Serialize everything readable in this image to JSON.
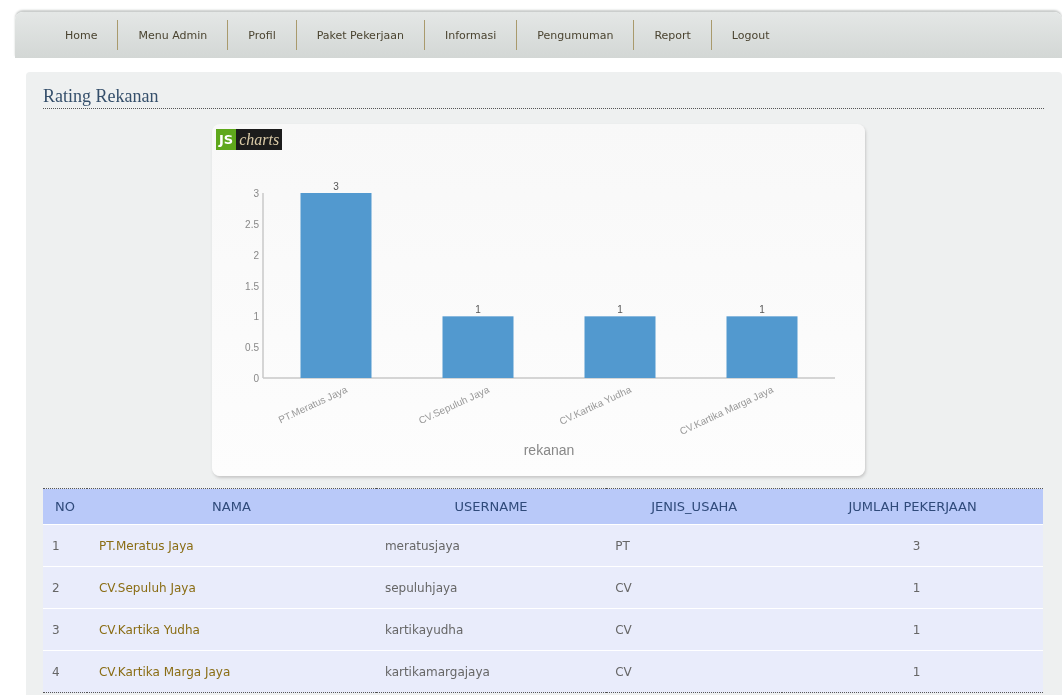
{
  "nav": {
    "items": [
      {
        "label": "Home"
      },
      {
        "label": "Menu Admin"
      },
      {
        "label": "Profil"
      },
      {
        "label": "Paket Pekerjaan"
      },
      {
        "label": "Informasi"
      },
      {
        "label": "Pengumuman"
      },
      {
        "label": "Report"
      },
      {
        "label": "Logout"
      }
    ]
  },
  "page_title": "Rating Rekanan",
  "chart": {
    "logo": {
      "left": "JS",
      "right": "charts"
    },
    "chart_data": {
      "type": "bar",
      "xlabel": "rekanan",
      "categories": [
        "PT.Meratus Jaya",
        "CV.Sepuluh Jaya",
        "CV.Kartika Yudha",
        "CV.Kartika Marga Jaya"
      ],
      "values": [
        3,
        1,
        1,
        1
      ],
      "ylim": [
        0,
        3
      ],
      "yticks": [
        0,
        0.5,
        1,
        1.5,
        2,
        2.5,
        3
      ],
      "data_labels": true
    }
  },
  "table": {
    "columns": [
      "NO",
      "NAMA",
      "USERNAME",
      "JENIS_USAHA",
      "JUMLAH PEKERJAAN"
    ],
    "rows": [
      [
        "1",
        "PT.Meratus Jaya",
        "meratusjaya",
        "PT",
        "3"
      ],
      [
        "2",
        "CV.Sepuluh Jaya",
        "sepuluhjaya",
        "CV",
        "1"
      ],
      [
        "3",
        "CV.Kartika Yudha",
        "kartikayudha",
        "CV",
        "1"
      ],
      [
        "4",
        "CV.Kartika Marga Jaya",
        "kartikamargajaya",
        "CV",
        "1"
      ]
    ]
  }
}
